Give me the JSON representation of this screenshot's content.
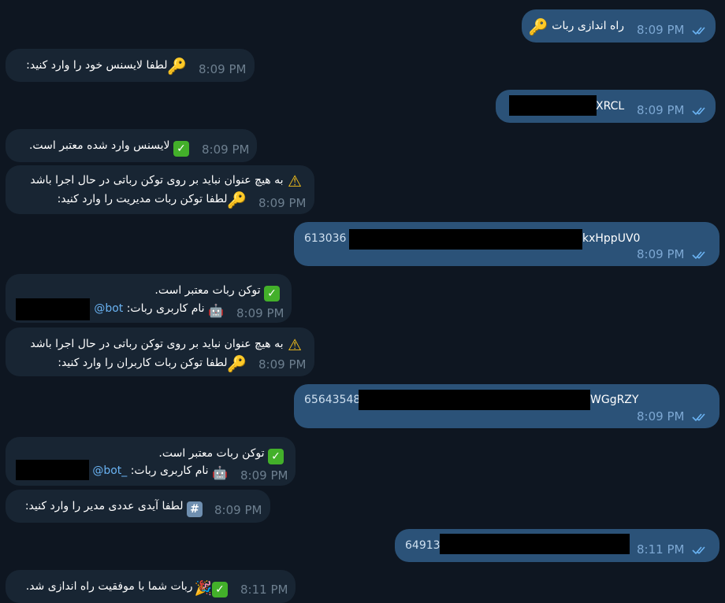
{
  "messages": [
    {
      "dir": "out",
      "text": "راه اندازی ربات",
      "time": "8:09 PM"
    },
    {
      "dir": "in",
      "text": "لطفا لایسنس خود را وارد کنید:",
      "time": "8:09 PM"
    },
    {
      "dir": "out",
      "text_visible": "XRCL",
      "time": "8:09 PM"
    },
    {
      "dir": "in",
      "text": "لایسنس وارد شده معتبر است.",
      "time": "8:09 PM"
    },
    {
      "dir": "in",
      "line1": "به هیچ عنوان نباید بر روی توکن رباتی در حال اجرا باشد",
      "line2": "لطفا توکن ربات مدیریت را وارد کنید:",
      "time": "8:09 PM"
    },
    {
      "dir": "out",
      "text_start": "613036",
      "text_end": "kxHppUV0",
      "time": "8:09 PM"
    },
    {
      "dir": "in",
      "line1": "توکن ربات معتبر است.",
      "line2_label": "نام کاربری ربات:",
      "line2_link": "bot@",
      "time": "8:09 PM"
    },
    {
      "dir": "in",
      "line1": "به هیچ عنوان نباید بر روی توکن رباتی در حال اجرا باشد",
      "line2": "لطفا توکن ربات کاربران را وارد کنید:",
      "time": "8:09 PM"
    },
    {
      "dir": "out",
      "text_start": "65643548",
      "text_end": "WGgRZY",
      "time": "8:09 PM"
    },
    {
      "dir": "in",
      "line1": "توکن ربات معتبر است.",
      "line2_label": "نام کاربری ربات:",
      "line2_link": "_bot@",
      "time": "8:09 PM"
    },
    {
      "dir": "in",
      "text": "لطفا آیدی عددی مدیر را وارد کنید:",
      "time": "8:09 PM"
    },
    {
      "dir": "out",
      "text_start": "64913",
      "time": "8:11 PM"
    },
    {
      "dir": "in",
      "text": "ربات شما با موفقیت راه اندازی شد.",
      "time": "8:11 PM"
    }
  ],
  "emoji": {
    "check": "✓",
    "key": "🔑",
    "warn": "⚠",
    "hash": "#",
    "robot": "🤖",
    "party": "🎉"
  },
  "icons": {
    "ticks": "double-check-icon",
    "key": "key-icon",
    "check": "check-mark-icon",
    "warn": "warning-icon",
    "hash": "hash-icon",
    "robot": "robot-icon",
    "party": "party-popper-icon"
  },
  "colors": {
    "background": "#0e1621",
    "incoming_bubble": "#182533",
    "outgoing_bubble": "#2b5278",
    "link": "#6ab3f3",
    "ticks": "#6ab3f3"
  }
}
